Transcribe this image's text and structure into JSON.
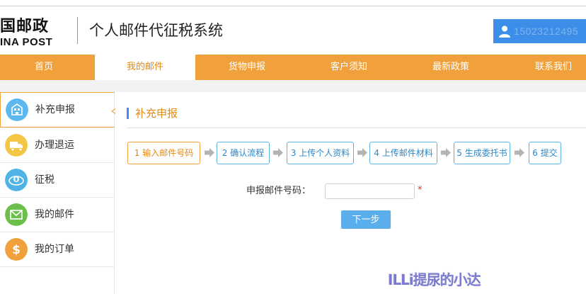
{
  "header": {
    "logo_cn": "国邮政",
    "logo_en": "INA POST",
    "system_title": "个人邮件代征税系统",
    "user_phone": "15023212495",
    "user_icon": "user-icon"
  },
  "nav": {
    "items": [
      {
        "label": "首页"
      },
      {
        "label": "我的邮件"
      },
      {
        "label": "货物申报"
      },
      {
        "label": "客户须知"
      },
      {
        "label": "最新政策"
      },
      {
        "label": "联系我们"
      }
    ],
    "active_index": 1
  },
  "sidebar": {
    "items": [
      {
        "label": "补充申报",
        "icon": "building-icon",
        "color": "#5cb8ef"
      },
      {
        "label": "办理退运",
        "icon": "truck-icon",
        "color": "#f3c646"
      },
      {
        "label": "征税",
        "icon": "tax-icon",
        "color": "#4fb3e5"
      },
      {
        "label": "我的邮件",
        "icon": "envelope-icon",
        "color": "#6cbf4a"
      },
      {
        "label": "我的订单",
        "icon": "dollar-icon",
        "color": "#f0a13c"
      }
    ],
    "active_index": 0
  },
  "content": {
    "title": "补充申报",
    "steps": [
      {
        "label": "1 输入邮件号码"
      },
      {
        "label": "2 确认流程"
      },
      {
        "label": "3 上传个人资料"
      },
      {
        "label": "4 上传邮件材料"
      },
      {
        "label": "5 生成委托书"
      },
      {
        "label": "6 提交"
      }
    ],
    "active_step": 0,
    "form": {
      "label": "申报邮件号码：",
      "value": "",
      "required_mark": "*"
    },
    "next_label": "下一步"
  },
  "watermark": "ILLi提尿的小达",
  "colors": {
    "accent_orange": "#f0a13c",
    "accent_blue": "#3d8ee8",
    "step_blue": "#5fb3e3",
    "button_blue": "#5aaeec"
  }
}
